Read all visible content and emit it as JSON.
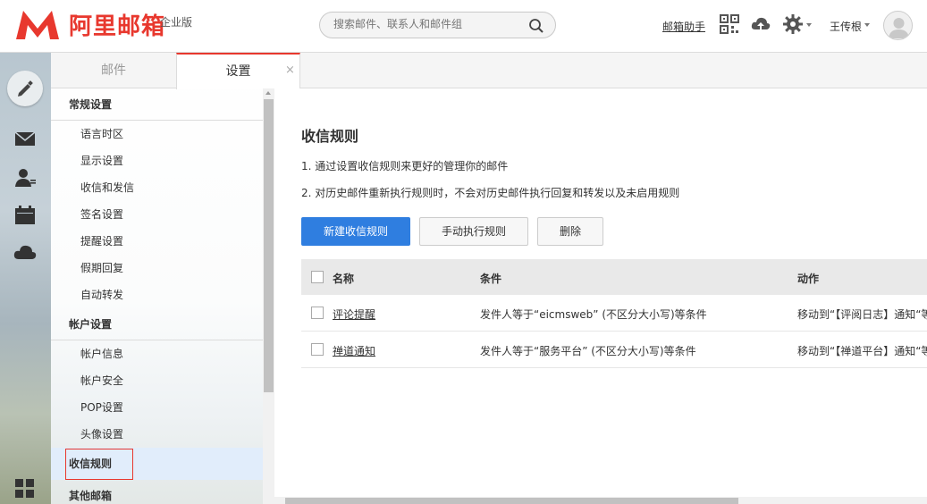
{
  "brand": {
    "name": "阿里邮箱",
    "edition": "企业版",
    "color": "#e8382e"
  },
  "search": {
    "placeholder": "搜索邮件、联系人和邮件组"
  },
  "header": {
    "helper_link": "邮箱助手",
    "user_name": "王传根",
    "icons": [
      "qrcode-icon",
      "cloud-upload-icon",
      "gear-icon",
      "avatar"
    ]
  },
  "leftbar": {
    "icons": [
      "compose-icon",
      "mail-icon",
      "contacts-icon",
      "calendar-icon",
      "cloud-icon",
      "apps-icon"
    ]
  },
  "tabs": [
    {
      "label": "邮件",
      "active": false
    },
    {
      "label": "设置",
      "active": true,
      "close": "×"
    }
  ],
  "nav": {
    "general": {
      "title": "常规设置",
      "items": [
        "语言时区",
        "显示设置",
        "收信和发信",
        "签名设置",
        "提醒设置",
        "假期回复",
        "自动转发"
      ]
    },
    "account": {
      "title": "帐户设置",
      "items": [
        "帐户信息",
        "帐户安全",
        "POP设置",
        "头像设置"
      ]
    },
    "active_item": "收信规则",
    "other": {
      "title": "其他邮箱"
    }
  },
  "main": {
    "title": "收信规则",
    "tips": [
      "1.  通过设置收信规则来更好的管理你的邮件",
      "2.  对历史邮件重新执行规则时，不会对历史邮件执行回复和转发以及未启用规则"
    ],
    "buttons": {
      "new": "新建收信规则",
      "run": "手动执行规则",
      "delete": "删除"
    },
    "table": {
      "headers": [
        "名称",
        "条件",
        "动作"
      ],
      "rows": [
        {
          "name": "评论提醒",
          "condition": "发件人等于“eicmsweb” (不区分大小写)等条件",
          "action": "移动到“【评阅日志】通知“等"
        },
        {
          "name": "禅道通知",
          "condition": "发件人等于“服务平台” (不区分大小写)等条件",
          "action": "移动到“【禅道平台】通知“等"
        }
      ]
    }
  },
  "colors": {
    "primary_button": "#2f7ee0",
    "active_nav_bg": "#e1edfb",
    "highlight_border": "#e8382e"
  }
}
